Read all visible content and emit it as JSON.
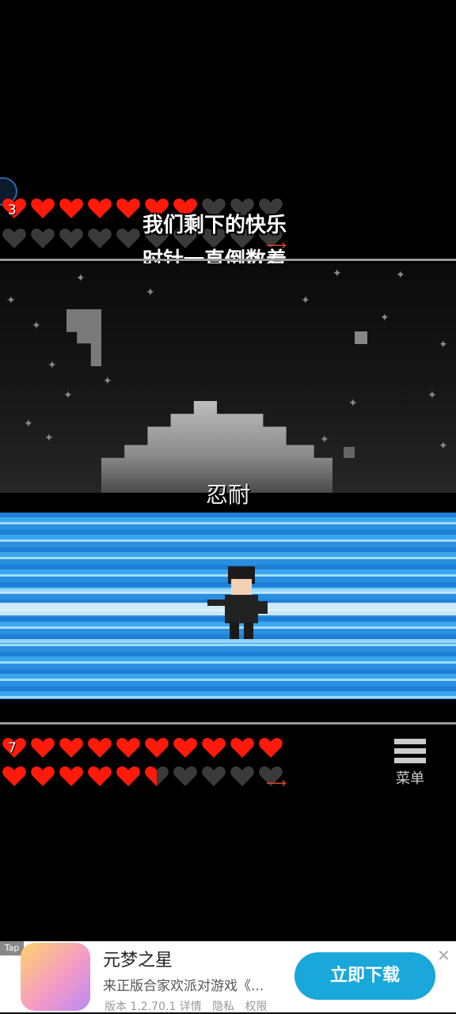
{
  "enemy": {
    "hp_row1": 3,
    "hp_row2_text": ""
  },
  "player": {
    "hp_row1": 7
  },
  "lyrics": {
    "line1": "我们剩下的快乐",
    "line2": "时针一直倒数着"
  },
  "battle": {
    "subtitle": "忍耐"
  },
  "menu": {
    "label": "菜单"
  },
  "ad": {
    "title": "元梦之星",
    "desc": "来正版合家欢派对游戏《...",
    "meta": "版本 1.2.70.1 详情   隐私   权限",
    "cta": "立即下载",
    "tag": "Tap"
  },
  "colors": {
    "heart_full": "#ff1a0a",
    "heart_empty": "#3a3a3a",
    "beam": "#2b8fe0"
  },
  "icons": {
    "menu": "menu-icon",
    "close": "close-icon",
    "heart": "heart-icon",
    "arrow": "arrow-icon"
  }
}
